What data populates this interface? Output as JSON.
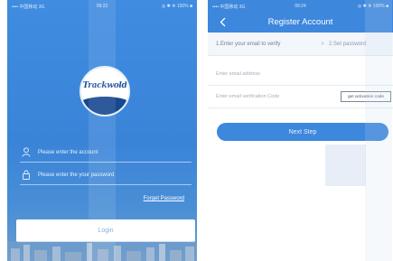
{
  "login": {
    "status": {
      "left": "•••• 中国移动  3G",
      "time": "09:22",
      "right": "◎ ✱ ❄ 100% ■"
    },
    "logo_text": "Trackwold",
    "account_placeholder": "Please enter the account",
    "password_placeholder": "Please enter the your password",
    "forgot_label": "Forget Password",
    "login_label": "Login"
  },
  "register": {
    "status": {
      "left": "•••• 中国移动  3G",
      "time": "09:24",
      "right": "◎ ✱ ❄ 100% ■"
    },
    "title": "Register Account",
    "steps": {
      "step1": "1.Enter your email to verify",
      "arrow": ">",
      "step2": "2.Set password"
    },
    "email_placeholder": "Enter email address",
    "code_placeholder": "Enter email verification Code",
    "send_code_label": "get activation code",
    "next_label": "Next Step"
  },
  "colors": {
    "primary": "#3d87dd",
    "login_bg": "#3a84d8"
  },
  "icons": [
    "user-icon",
    "lock-icon",
    "back-arrow-icon"
  ]
}
